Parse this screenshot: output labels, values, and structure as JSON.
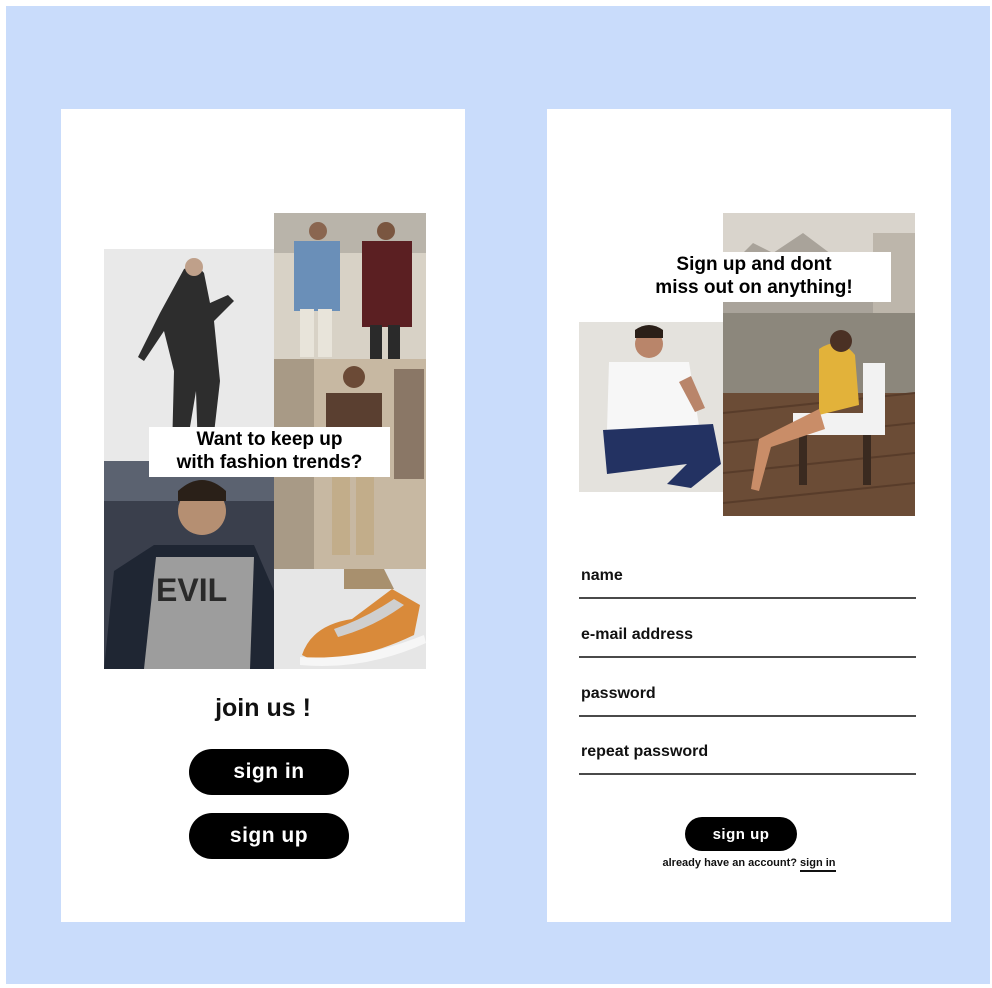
{
  "left_screen": {
    "headline": [
      "Want to keep up",
      "with fashion trends?"
    ],
    "title": "join us !",
    "sign_in_label": "sign in",
    "sign_up_label": "sign up"
  },
  "right_screen": {
    "headline": [
      "Sign up and dont",
      "miss out on anything!"
    ],
    "fields": [
      {
        "label": "name"
      },
      {
        "label": "e-mail address"
      },
      {
        "label": "password"
      },
      {
        "label": "repeat password"
      }
    ],
    "sign_up_label": "sign up",
    "account_prompt": "already have an account?",
    "sign_in_link": "sign in"
  },
  "colors": {
    "background": "#c9dcfb",
    "card": "#ffffff",
    "button": "#000000",
    "button_text": "#ffffff"
  }
}
